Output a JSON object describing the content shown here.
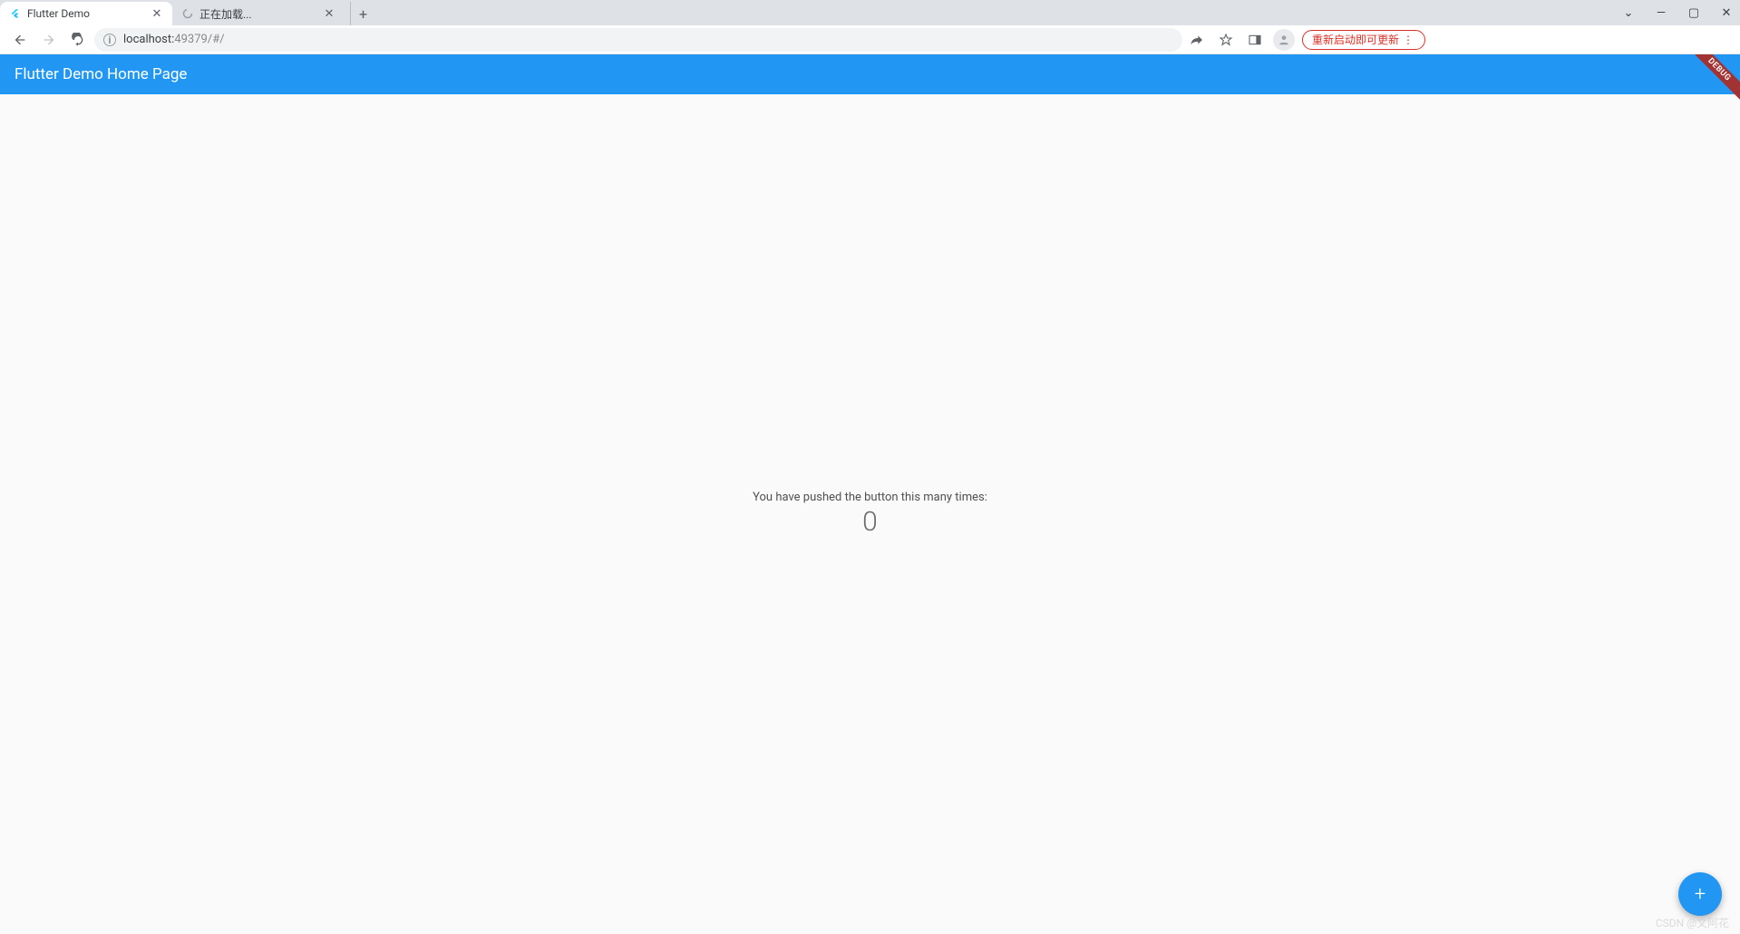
{
  "chrome": {
    "tabs": [
      {
        "title": "Flutter Demo",
        "active": true,
        "favicon": "flutter-icon"
      },
      {
        "title": "正在加载...",
        "active": false,
        "favicon": "spinner-icon"
      }
    ],
    "address": {
      "host": "localhost:",
      "port_path": "49379/#/"
    },
    "update_button": "重新启动即可更新"
  },
  "app": {
    "appbar_title": "Flutter Demo Home Page",
    "body": {
      "message": "You have pushed the button this many times:",
      "counter": "0"
    },
    "debug_label": "DEBUG",
    "fab_tooltip": "Increment"
  },
  "watermark": "CSDN @文阿花"
}
